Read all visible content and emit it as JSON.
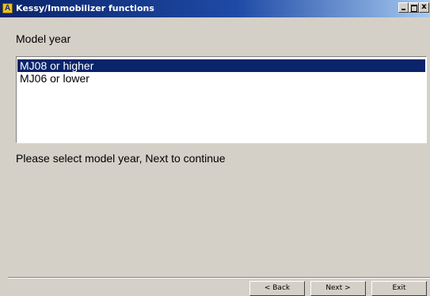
{
  "window": {
    "app_icon_letter": "A",
    "title": "Kessy/Immobilizer functions",
    "close_glyph": "x"
  },
  "section": {
    "label": "Model year"
  },
  "model_year_list": {
    "items": [
      {
        "label": "MJ08 or higher",
        "selected": true
      },
      {
        "label": "MJ06 or lower",
        "selected": false
      }
    ]
  },
  "status": {
    "message": "Please select model year, Next to continue"
  },
  "buttons": {
    "back": "< Back",
    "next": "Next >",
    "exit": "Exit"
  },
  "colors": {
    "selection": "#0a246a",
    "title_bar": "#0a246a",
    "window_background": "#d4d0c8"
  }
}
